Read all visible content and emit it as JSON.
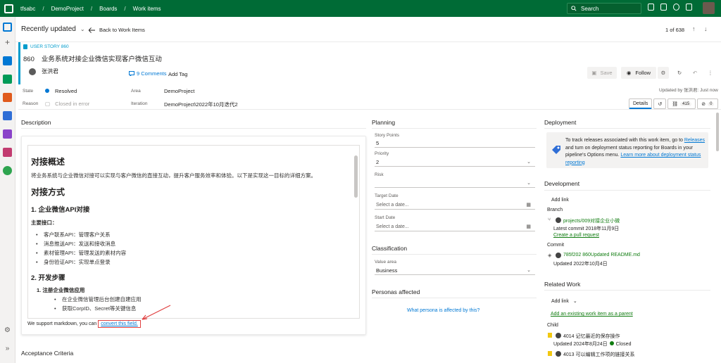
{
  "topbar": {
    "crumbs": [
      "tfsabc",
      "DemoProject",
      "Boards",
      "Work items"
    ],
    "search_placeholder": "Search",
    "colors": {
      "brand": "#006b36"
    }
  },
  "header": {
    "recent": "Recently updated",
    "back": "Back to Work Items",
    "pager": "1 of 638"
  },
  "work_item": {
    "type": "USER STORY 860",
    "id": "860",
    "title": "业务系统对接企业微信实现客户微信互动",
    "assignee": "张洪君",
    "comments": "9 Comments",
    "add_tag": "Add Tag",
    "save": "Save",
    "follow": "Follow",
    "updated_by": "Updated by 张洪君: Just now"
  },
  "fields": {
    "state_label": "State",
    "state_value": "Resolved",
    "reason_label": "Reason",
    "reason_value": "Closed in error",
    "area_label": "Area",
    "area_value": "DemoProject",
    "iteration_label": "Iteration",
    "iteration_value": "DemoProject\\2022年10月迭代2"
  },
  "tabs": {
    "details": "Details",
    "links_count": "415",
    "attach_count": "0"
  },
  "description": {
    "heading": "Description",
    "h_overview": "对接概述",
    "p_overview": "将业务系统与企业微信对接可以实现与客户微信的直接互动，提升客户服务效率和体验。以下是实现这一目标的详细方案。",
    "h_method": "对接方式",
    "h_api": "1. 企业微信API对接",
    "main_if": "主要接口：",
    "api_items": [
      "客户联系API：管理客户关系",
      "消息推送API：发送和接收消息",
      "素材管理API：管理发送的素材内容",
      "身份验证API：实现单点登录"
    ],
    "h_steps": "2. 开发步骤",
    "step1": "1. 注册企业微信应用",
    "step1_items": [
      "在企业微信管理后台创建自建应用",
      "获取CorpID、Secret等关键信息"
    ],
    "markdown_text": "We support markdown, you can ",
    "markdown_link": "convert this field.",
    "acceptance": "Acceptance Criteria"
  },
  "planning": {
    "heading": "Planning",
    "story_points_label": "Story Points",
    "story_points": "5",
    "priority_label": "Priority",
    "priority": "2",
    "risk_label": "Risk",
    "target_label": "Target Date",
    "target_ph": "Select a date...",
    "start_label": "Start Date",
    "start_ph": "Select a date...",
    "classification": "Classification",
    "value_area_label": "Value area",
    "value_area": "Business",
    "personas": "Personas affected",
    "personas_q": "What persona is affected by this?"
  },
  "deployment": {
    "heading": "Deployment",
    "text1": "To track releases associated with this work item, go to ",
    "releases": "Releases",
    "text2": " and turn on deployment status reporting for Boards in your pipeline's Options menu. ",
    "learn": "Learn more about deployment status reporting"
  },
  "development": {
    "heading": "Development",
    "add_link": "Add link",
    "branch_label": "Branch",
    "branch": "projects/009对接企业小微",
    "branch_commit": "Latest commit 2018年11月9日",
    "create_pr": "Create a pull request",
    "commit_label": "Commit",
    "commit": "785f202 860Updated README.md",
    "commit_date": "Updated 2022年10月4日"
  },
  "related": {
    "heading": "Related Work",
    "add_link": "Add link",
    "add_existing": "Add an existing work item as a parent",
    "child_label": "Child",
    "child1": "4014 记忆最近的保存操作",
    "child1_date": "Updated 2024年8月24日",
    "child1_status": "Closed",
    "child2": "4013 可以编辑工作项的链接关系"
  }
}
